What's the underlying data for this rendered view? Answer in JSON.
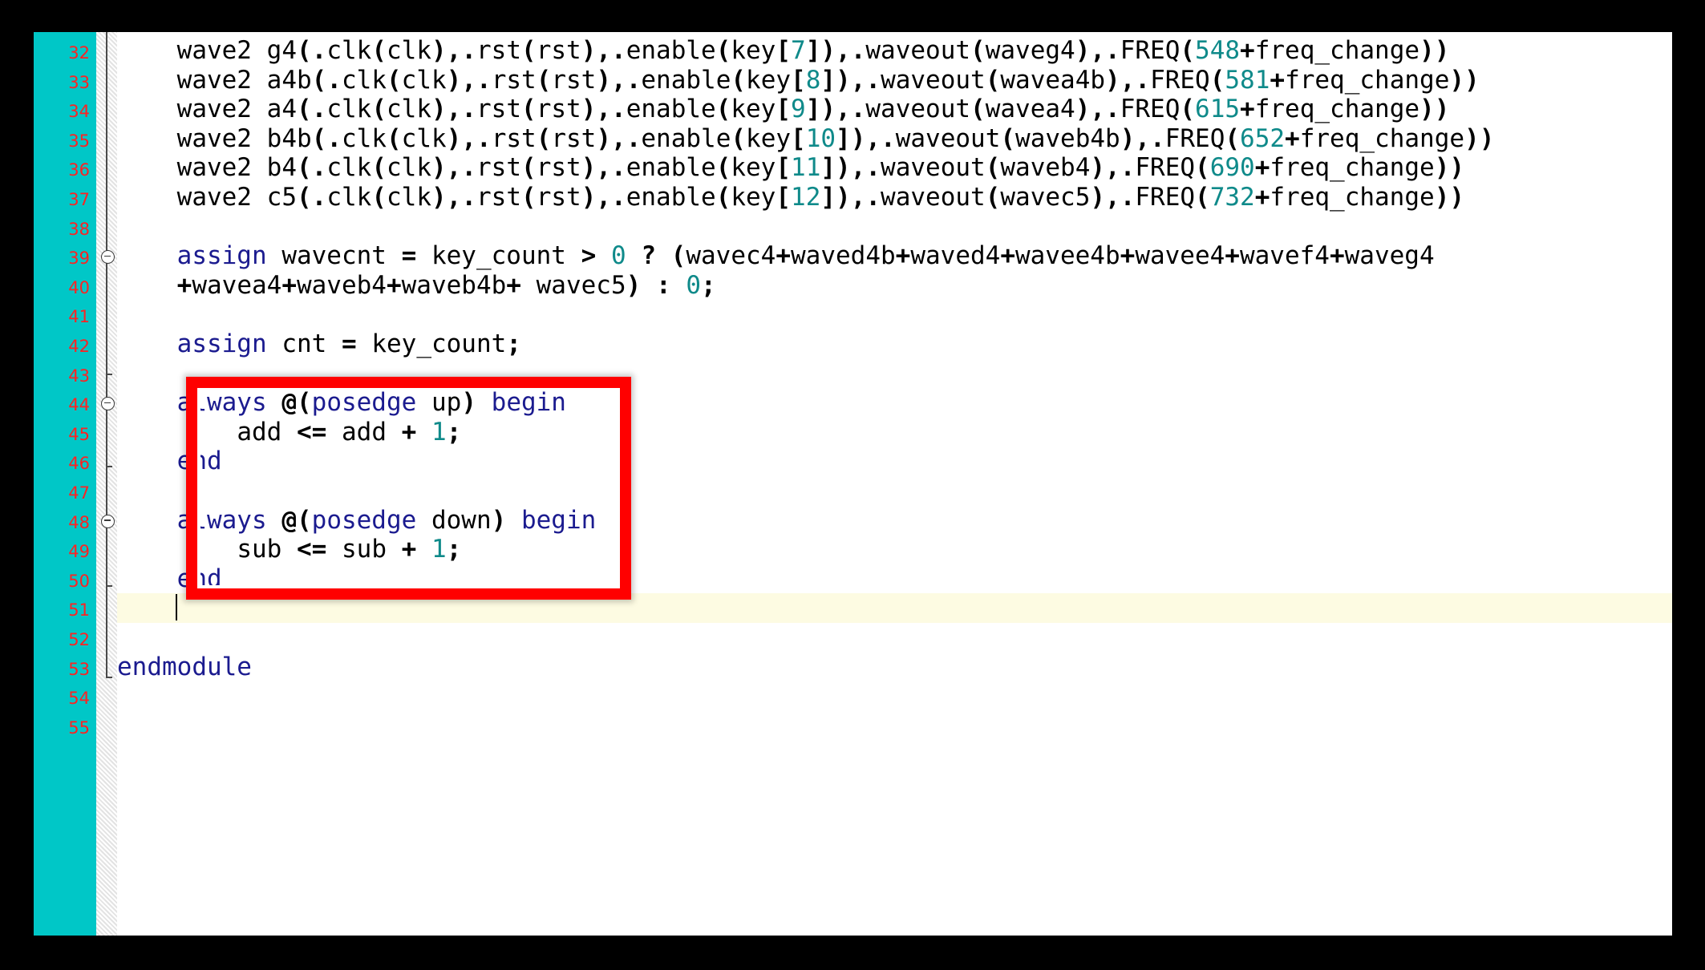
{
  "editor": {
    "gutter_bg": "#00c7c7",
    "lineno_color": "#ff2222",
    "keyword_color": "#1b1b8f",
    "number_color": "#0f8a8a",
    "current_line_bg": "#fdfbe2",
    "highlight_color": "#ff0000",
    "current_line": 51,
    "first_visible_line": 32,
    "last_visible_line": 55
  },
  "line_numbers": [
    32,
    33,
    34,
    35,
    36,
    37,
    38,
    39,
    40,
    41,
    42,
    43,
    44,
    45,
    46,
    47,
    48,
    49,
    50,
    51,
    52,
    53,
    54,
    55
  ],
  "lines": [
    {
      "n": 32,
      "text": "    wave2 g4(.clk(clk),.rst(rst),.enable(key[7]),.waveout(waveg4),.FREQ(548+freq_change))"
    },
    {
      "n": 33,
      "text": "    wave2 a4b(.clk(clk),.rst(rst),.enable(key[8]),.waveout(wavea4b),.FREQ(581+freq_change))"
    },
    {
      "n": 34,
      "text": "    wave2 a4(.clk(clk),.rst(rst),.enable(key[9]),.waveout(wavea4),.FREQ(615+freq_change))"
    },
    {
      "n": 35,
      "text": "    wave2 b4b(.clk(clk),.rst(rst),.enable(key[10]),.waveout(waveb4b),.FREQ(652+freq_change))"
    },
    {
      "n": 36,
      "text": "    wave2 b4(.clk(clk),.rst(rst),.enable(key[11]),.waveout(waveb4),.FREQ(690+freq_change))"
    },
    {
      "n": 37,
      "text": "    wave2 c5(.clk(clk),.rst(rst),.enable(key[12]),.waveout(wavec5),.FREQ(732+freq_change))"
    },
    {
      "n": 38,
      "text": ""
    },
    {
      "n": 39,
      "text": "    assign wavecnt = key_count > 0 ? (wavec4+waved4b+waved4+wavee4b+wavee4+wavef4+waveg4"
    },
    {
      "n": 40,
      "text": "    +wavea4+waveb4+waveb4b+ wavec5) : 0;"
    },
    {
      "n": 41,
      "text": ""
    },
    {
      "n": 42,
      "text": "    assign cnt = key_count;"
    },
    {
      "n": 43,
      "text": ""
    },
    {
      "n": 44,
      "text": "    always @(posedge up) begin"
    },
    {
      "n": 45,
      "text": "        add <= add + 1;"
    },
    {
      "n": 46,
      "text": "    end"
    },
    {
      "n": 47,
      "text": ""
    },
    {
      "n": 48,
      "text": "    always @(posedge down) begin"
    },
    {
      "n": 49,
      "text": "        sub <= sub + 1;"
    },
    {
      "n": 50,
      "text": "    end"
    },
    {
      "n": 51,
      "text": "    "
    },
    {
      "n": 52,
      "text": ""
    },
    {
      "n": 53,
      "text": "endmodule"
    },
    {
      "n": 54,
      "text": ""
    },
    {
      "n": 55,
      "text": ""
    }
  ],
  "fold_markers": [
    {
      "line": 39,
      "type": "collapse-icon"
    },
    {
      "line": 44,
      "type": "collapse-icon"
    },
    {
      "line": 48,
      "type": "collapse-icon"
    }
  ],
  "annotation": {
    "shape": "rectangle",
    "label": "red-highlight-box",
    "covers_lines": "44-50"
  },
  "caret": {
    "line": 51,
    "column": 5
  }
}
